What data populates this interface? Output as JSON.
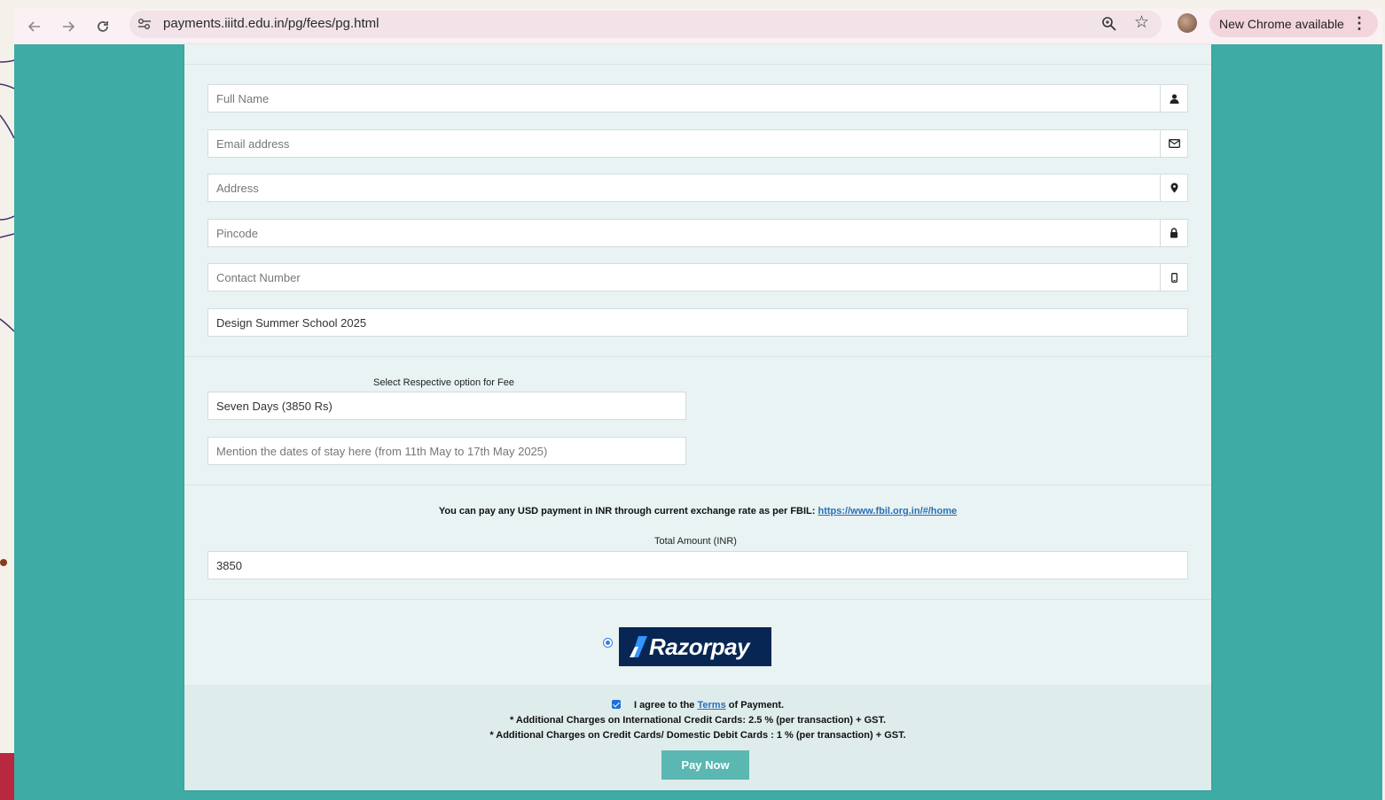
{
  "browser": {
    "url": "payments.iiitd.edu.in/pg/fees/pg.html",
    "update_label": "New Chrome available"
  },
  "form": {
    "full_name_placeholder": "Full Name",
    "email_placeholder": "Email address",
    "address_placeholder": "Address",
    "pincode_placeholder": "Pincode",
    "contact_placeholder": "Contact Number",
    "program_value": "Design Summer School 2025",
    "fee_option_label": "Select Respective option for Fee",
    "fee_option_value": "Seven Days (3850 Rs)",
    "dates_placeholder": "Mention the dates of stay here (from 11th May to 17th May 2025)",
    "fbil_note": "You can pay any USD payment in INR through current exchange rate as per FBIL:",
    "fbil_link": "https://www.fbil.org.in/#/home",
    "total_label": "Total Amount (INR)",
    "total_value": "3850"
  },
  "payment": {
    "gateway_name": "Razorpay",
    "gateway_selected": true
  },
  "footer": {
    "agree_prefix": "I agree to the",
    "agree_link": "Terms",
    "agree_suffix": "of Payment.",
    "agree_checked": true,
    "charge_international": "* Additional Charges on International Credit Cards: 2.5 % (per transaction) + GST.",
    "charge_domestic": "* Additional Charges on Credit Cards/ Domestic Debit Cards : 1 % (per transaction) + GST.",
    "pay_button": "Pay Now"
  },
  "colors": {
    "page_background": "#3eaba5",
    "card_background": "#e9f3f3",
    "pay_button": "#5bb7b1",
    "razorpay_navy": "#072654",
    "link": "#2a6fb5"
  },
  "icons": {
    "full_name": "user-icon",
    "email": "envelope-icon",
    "address": "map-marker-icon",
    "pincode": "lock-icon",
    "contact": "mobile-phone-icon"
  }
}
